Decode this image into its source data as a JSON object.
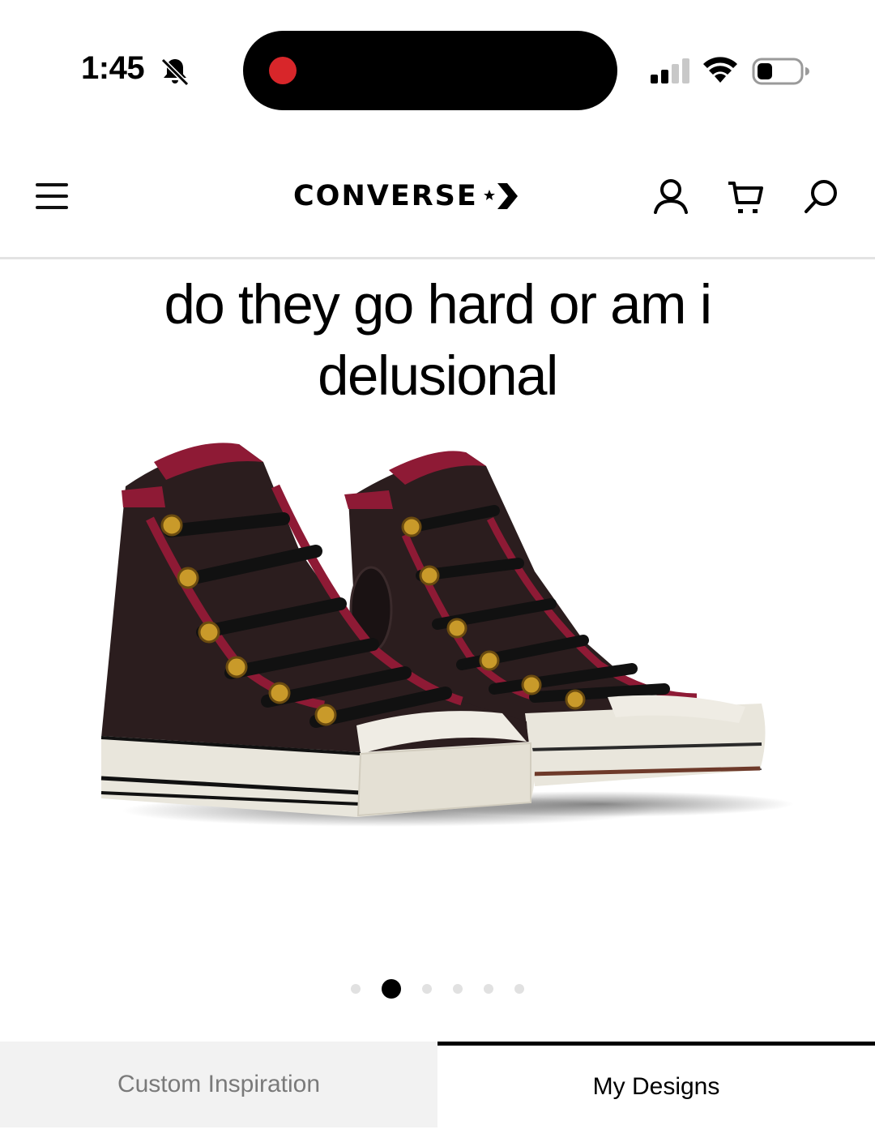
{
  "status_bar": {
    "time": "1:45",
    "silent_icon": "bell-slash-icon",
    "recording_color": "#d8262a",
    "signal_icon": "cellular-signal-icon",
    "wifi_icon": "wifi-icon",
    "battery_icon": "battery-low-icon"
  },
  "header": {
    "menu_icon": "hamburger-menu-icon",
    "brand": "CONVERSE",
    "account_icon": "account-icon",
    "cart_icon": "cart-icon",
    "search_icon": "search-icon"
  },
  "caption": {
    "text": "do they go hard or am i delusional"
  },
  "product": {
    "image": "custom-high-top-sneakers",
    "colors": {
      "upper": "#2b1d1e",
      "trim": "#8e1a35",
      "sole": "#e9e6dc",
      "eyelet": "#c99a2a"
    }
  },
  "carousel": {
    "count": 6,
    "active_index": 1
  },
  "tabs": [
    {
      "label": "Custom Inspiration",
      "active": false
    },
    {
      "label": "My Designs",
      "active": true
    }
  ]
}
